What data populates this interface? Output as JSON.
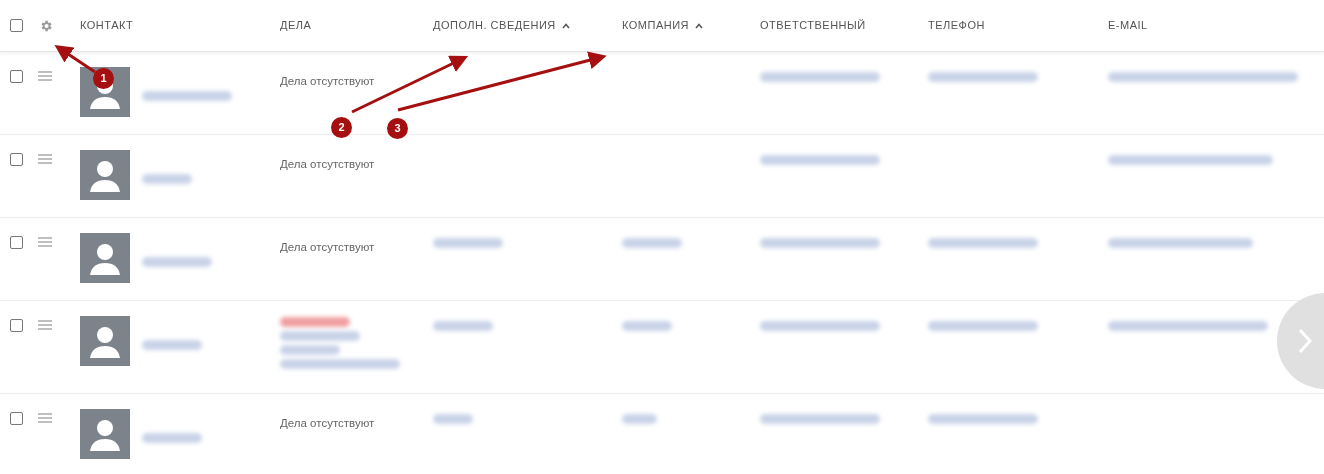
{
  "table": {
    "columns": [
      {
        "label": "КОНТАКТ",
        "sorted": false
      },
      {
        "label": "ДЕЛА",
        "sorted": false
      },
      {
        "label": "ДОПОЛН. СВЕДЕНИЯ",
        "sorted": true
      },
      {
        "label": "КОМПАНИЯ",
        "sorted": true
      },
      {
        "label": "ОТВЕТСТВЕННЫЙ",
        "sorted": false
      },
      {
        "label": "ТЕЛЕФОН",
        "sorted": false
      },
      {
        "label": "E-MAIL",
        "sorted": false
      }
    ],
    "rows": [
      {
        "checked": false,
        "deals": "Дела отсутствуют"
      },
      {
        "checked": false,
        "deals": "Дела отсутствуют"
      },
      {
        "checked": false,
        "deals": "Дела отсутствуют"
      },
      {
        "checked": false
      },
      {
        "checked": false,
        "deals": "Дела отсутствуют"
      }
    ],
    "all_checked": false
  },
  "annotations": [
    {
      "label": "1"
    },
    {
      "label": "2"
    },
    {
      "label": "3"
    }
  ]
}
